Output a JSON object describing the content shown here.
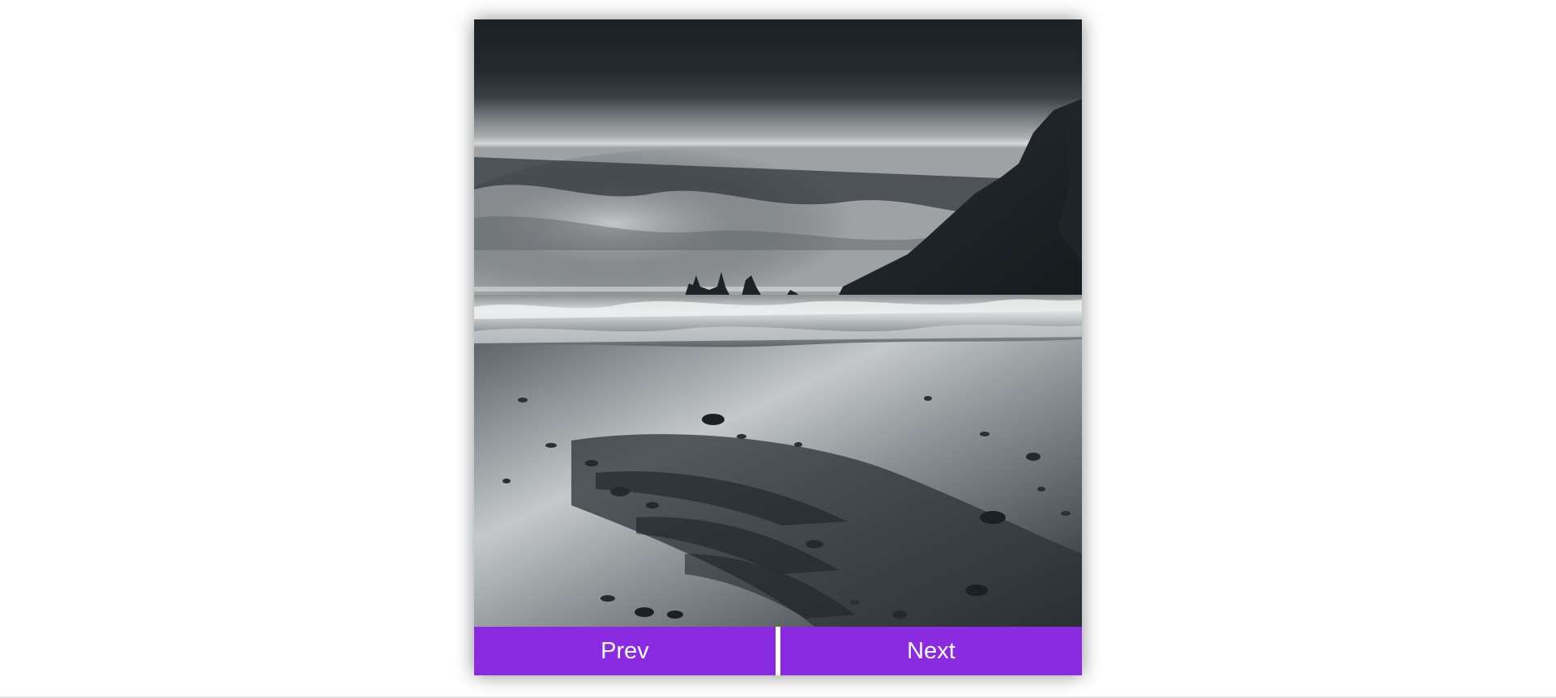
{
  "slider": {
    "image_alt": "",
    "prev_label": "Prev",
    "next_label": "Next",
    "button_color": "#8a2be2"
  }
}
